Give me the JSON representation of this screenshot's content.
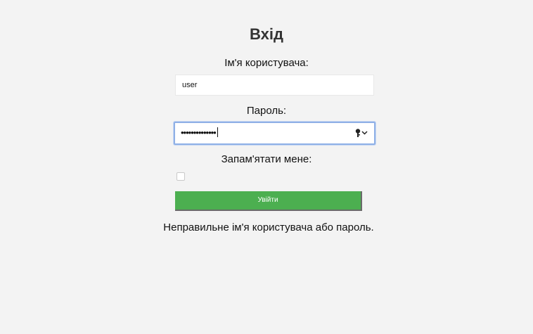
{
  "form": {
    "title": "Вхід",
    "username_label": "Ім'я користувача:",
    "username_value": "user",
    "password_label": "Пароль:",
    "password_masked": "••••••••••••••",
    "remember_label": "Запам'ятати мене:",
    "remember_checked": false,
    "submit_label": "Увійти",
    "error_text": "Неправильне ім'я користувача або пароль."
  },
  "colors": {
    "background": "#f3f3f3",
    "submit_button": "#4caf50",
    "focus_border": "#8fb0e6"
  },
  "icons": {
    "password_manager": "key-dropdown-icon"
  }
}
